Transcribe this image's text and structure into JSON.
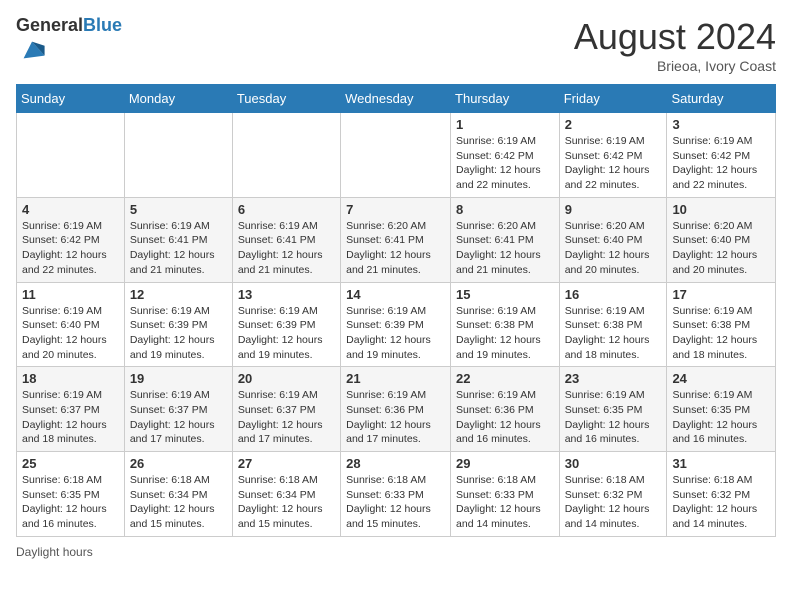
{
  "header": {
    "logo_general": "General",
    "logo_blue": "Blue",
    "month_year": "August 2024",
    "location": "Brieoa, Ivory Coast"
  },
  "days_of_week": [
    "Sunday",
    "Monday",
    "Tuesday",
    "Wednesday",
    "Thursday",
    "Friday",
    "Saturday"
  ],
  "weeks": [
    [
      {
        "day": "",
        "info": ""
      },
      {
        "day": "",
        "info": ""
      },
      {
        "day": "",
        "info": ""
      },
      {
        "day": "",
        "info": ""
      },
      {
        "day": "1",
        "info": "Sunrise: 6:19 AM\nSunset: 6:42 PM\nDaylight: 12 hours and 22 minutes."
      },
      {
        "day": "2",
        "info": "Sunrise: 6:19 AM\nSunset: 6:42 PM\nDaylight: 12 hours and 22 minutes."
      },
      {
        "day": "3",
        "info": "Sunrise: 6:19 AM\nSunset: 6:42 PM\nDaylight: 12 hours and 22 minutes."
      }
    ],
    [
      {
        "day": "4",
        "info": "Sunrise: 6:19 AM\nSunset: 6:42 PM\nDaylight: 12 hours and 22 minutes."
      },
      {
        "day": "5",
        "info": "Sunrise: 6:19 AM\nSunset: 6:41 PM\nDaylight: 12 hours and 21 minutes."
      },
      {
        "day": "6",
        "info": "Sunrise: 6:19 AM\nSunset: 6:41 PM\nDaylight: 12 hours and 21 minutes."
      },
      {
        "day": "7",
        "info": "Sunrise: 6:20 AM\nSunset: 6:41 PM\nDaylight: 12 hours and 21 minutes."
      },
      {
        "day": "8",
        "info": "Sunrise: 6:20 AM\nSunset: 6:41 PM\nDaylight: 12 hours and 21 minutes."
      },
      {
        "day": "9",
        "info": "Sunrise: 6:20 AM\nSunset: 6:40 PM\nDaylight: 12 hours and 20 minutes."
      },
      {
        "day": "10",
        "info": "Sunrise: 6:20 AM\nSunset: 6:40 PM\nDaylight: 12 hours and 20 minutes."
      }
    ],
    [
      {
        "day": "11",
        "info": "Sunrise: 6:19 AM\nSunset: 6:40 PM\nDaylight: 12 hours and 20 minutes."
      },
      {
        "day": "12",
        "info": "Sunrise: 6:19 AM\nSunset: 6:39 PM\nDaylight: 12 hours and 19 minutes."
      },
      {
        "day": "13",
        "info": "Sunrise: 6:19 AM\nSunset: 6:39 PM\nDaylight: 12 hours and 19 minutes."
      },
      {
        "day": "14",
        "info": "Sunrise: 6:19 AM\nSunset: 6:39 PM\nDaylight: 12 hours and 19 minutes."
      },
      {
        "day": "15",
        "info": "Sunrise: 6:19 AM\nSunset: 6:38 PM\nDaylight: 12 hours and 19 minutes."
      },
      {
        "day": "16",
        "info": "Sunrise: 6:19 AM\nSunset: 6:38 PM\nDaylight: 12 hours and 18 minutes."
      },
      {
        "day": "17",
        "info": "Sunrise: 6:19 AM\nSunset: 6:38 PM\nDaylight: 12 hours and 18 minutes."
      }
    ],
    [
      {
        "day": "18",
        "info": "Sunrise: 6:19 AM\nSunset: 6:37 PM\nDaylight: 12 hours and 18 minutes."
      },
      {
        "day": "19",
        "info": "Sunrise: 6:19 AM\nSunset: 6:37 PM\nDaylight: 12 hours and 17 minutes."
      },
      {
        "day": "20",
        "info": "Sunrise: 6:19 AM\nSunset: 6:37 PM\nDaylight: 12 hours and 17 minutes."
      },
      {
        "day": "21",
        "info": "Sunrise: 6:19 AM\nSunset: 6:36 PM\nDaylight: 12 hours and 17 minutes."
      },
      {
        "day": "22",
        "info": "Sunrise: 6:19 AM\nSunset: 6:36 PM\nDaylight: 12 hours and 16 minutes."
      },
      {
        "day": "23",
        "info": "Sunrise: 6:19 AM\nSunset: 6:35 PM\nDaylight: 12 hours and 16 minutes."
      },
      {
        "day": "24",
        "info": "Sunrise: 6:19 AM\nSunset: 6:35 PM\nDaylight: 12 hours and 16 minutes."
      }
    ],
    [
      {
        "day": "25",
        "info": "Sunrise: 6:18 AM\nSunset: 6:35 PM\nDaylight: 12 hours and 16 minutes."
      },
      {
        "day": "26",
        "info": "Sunrise: 6:18 AM\nSunset: 6:34 PM\nDaylight: 12 hours and 15 minutes."
      },
      {
        "day": "27",
        "info": "Sunrise: 6:18 AM\nSunset: 6:34 PM\nDaylight: 12 hours and 15 minutes."
      },
      {
        "day": "28",
        "info": "Sunrise: 6:18 AM\nSunset: 6:33 PM\nDaylight: 12 hours and 15 minutes."
      },
      {
        "day": "29",
        "info": "Sunrise: 6:18 AM\nSunset: 6:33 PM\nDaylight: 12 hours and 14 minutes."
      },
      {
        "day": "30",
        "info": "Sunrise: 6:18 AM\nSunset: 6:32 PM\nDaylight: 12 hours and 14 minutes."
      },
      {
        "day": "31",
        "info": "Sunrise: 6:18 AM\nSunset: 6:32 PM\nDaylight: 12 hours and 14 minutes."
      }
    ]
  ],
  "footer": {
    "daylight_label": "Daylight hours"
  }
}
